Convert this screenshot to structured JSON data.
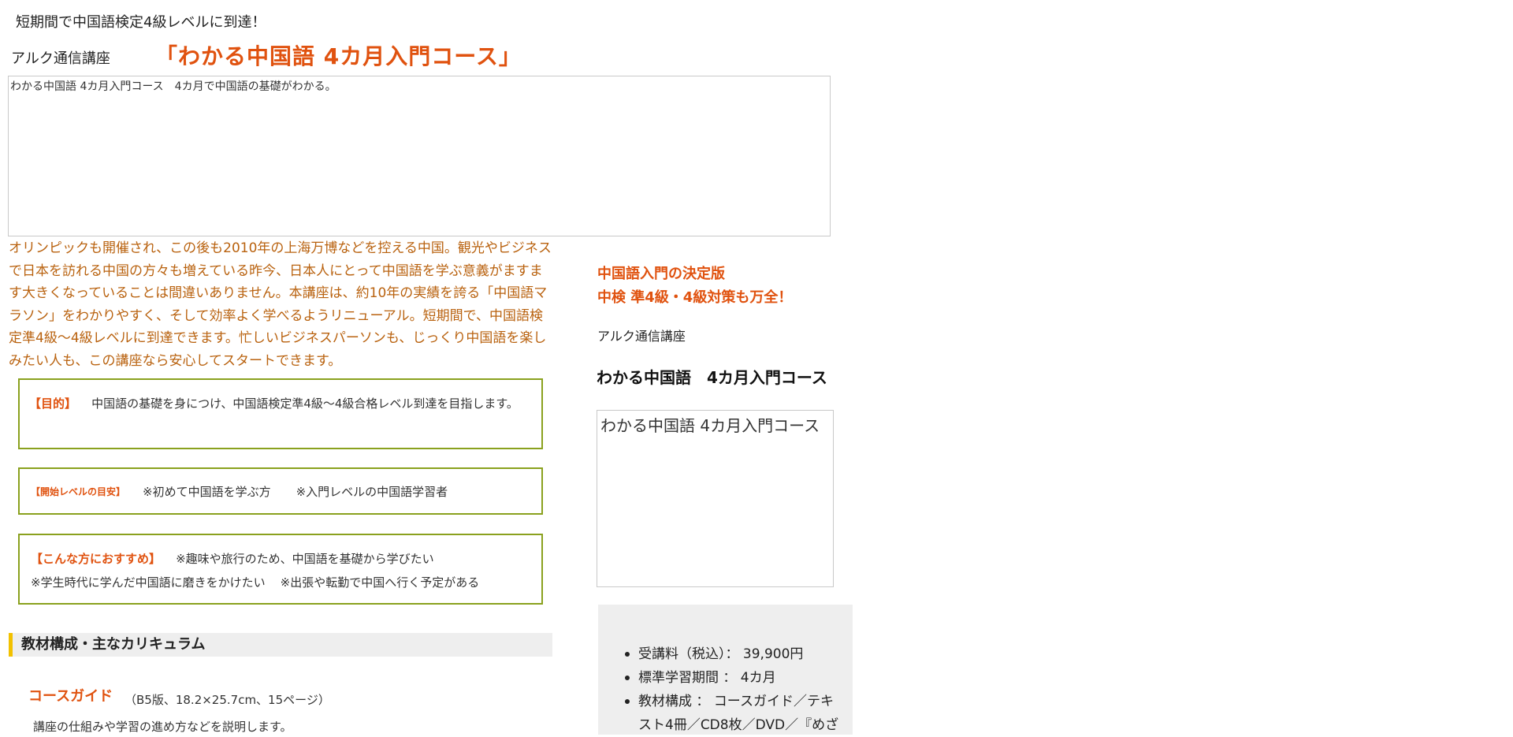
{
  "header": {
    "tagline": "短期間で中国語検定4級レベルに到達！",
    "provider": "アルク通信講座",
    "course_title": "「わかる中国語 4カ月入門コース」"
  },
  "banner": {
    "alt": "わかる中国語 4カ月入門コース　4カ月で中国語の基礎がわかる。"
  },
  "intro": "オリンピックも開催され、この後も2010年の上海万博などを控える中国。観光やビジネスで日本を訪れる中国の方々も増えている昨今、日本人にとって中国語を学ぶ意義がますます大きくなっていることは間違いありません。本講座は、約10年の実績を誇る「中国語マラソン」をわかりやすく、そして効率よく学べるようリニューアル。短期間で、中国語検定準4級～4級レベルに到達できます。忙しいビジネスパーソンも、じっくり中国語を楽しみたい人も、この講座なら安心してスタートできます。",
  "purpose": {
    "label": "【目的】",
    "text": "中国語の基礎を身につけ、中国語検定準4級～4級合格レベル到達を目指します。"
  },
  "start_level": {
    "label": "【開始レベルの目安】",
    "items": [
      "※初めて中国語を学ぶ方",
      "※入門レベルの中国語学習者"
    ]
  },
  "recommend": {
    "label": "【こんな方におすすめ】",
    "items": [
      "※趣味や旅行のため、中国語を基礎から学びたい",
      "※学生時代に学んだ中国語に磨きをかけたい",
      "※出張や転勤で中国へ行く予定がある"
    ]
  },
  "curriculum": {
    "heading": "教材構成・主なカリキュラム",
    "guide_title": "コースガイド",
    "guide_spec": "（B5版、18.2×25.7cm、15ページ）",
    "guide_desc": "講座の仕組みや学習の進め方などを説明します。"
  },
  "sidebar": {
    "headline_1": "中国語入門の決定版",
    "headline_2": "中検 準4級・4級対策も万全！",
    "provider": "アルク通信講座",
    "title": "わかる中国語　4カ月入門コース",
    "image_alt": "わかる中国語 4カ月入門コース",
    "info": [
      "受講料（税込）： 39,900円",
      "標準学習期間 ： 4カ月",
      "教材構成 ： コースガイド／テキスト4冊／CD8枚／DVD／『めざ"
    ]
  }
}
